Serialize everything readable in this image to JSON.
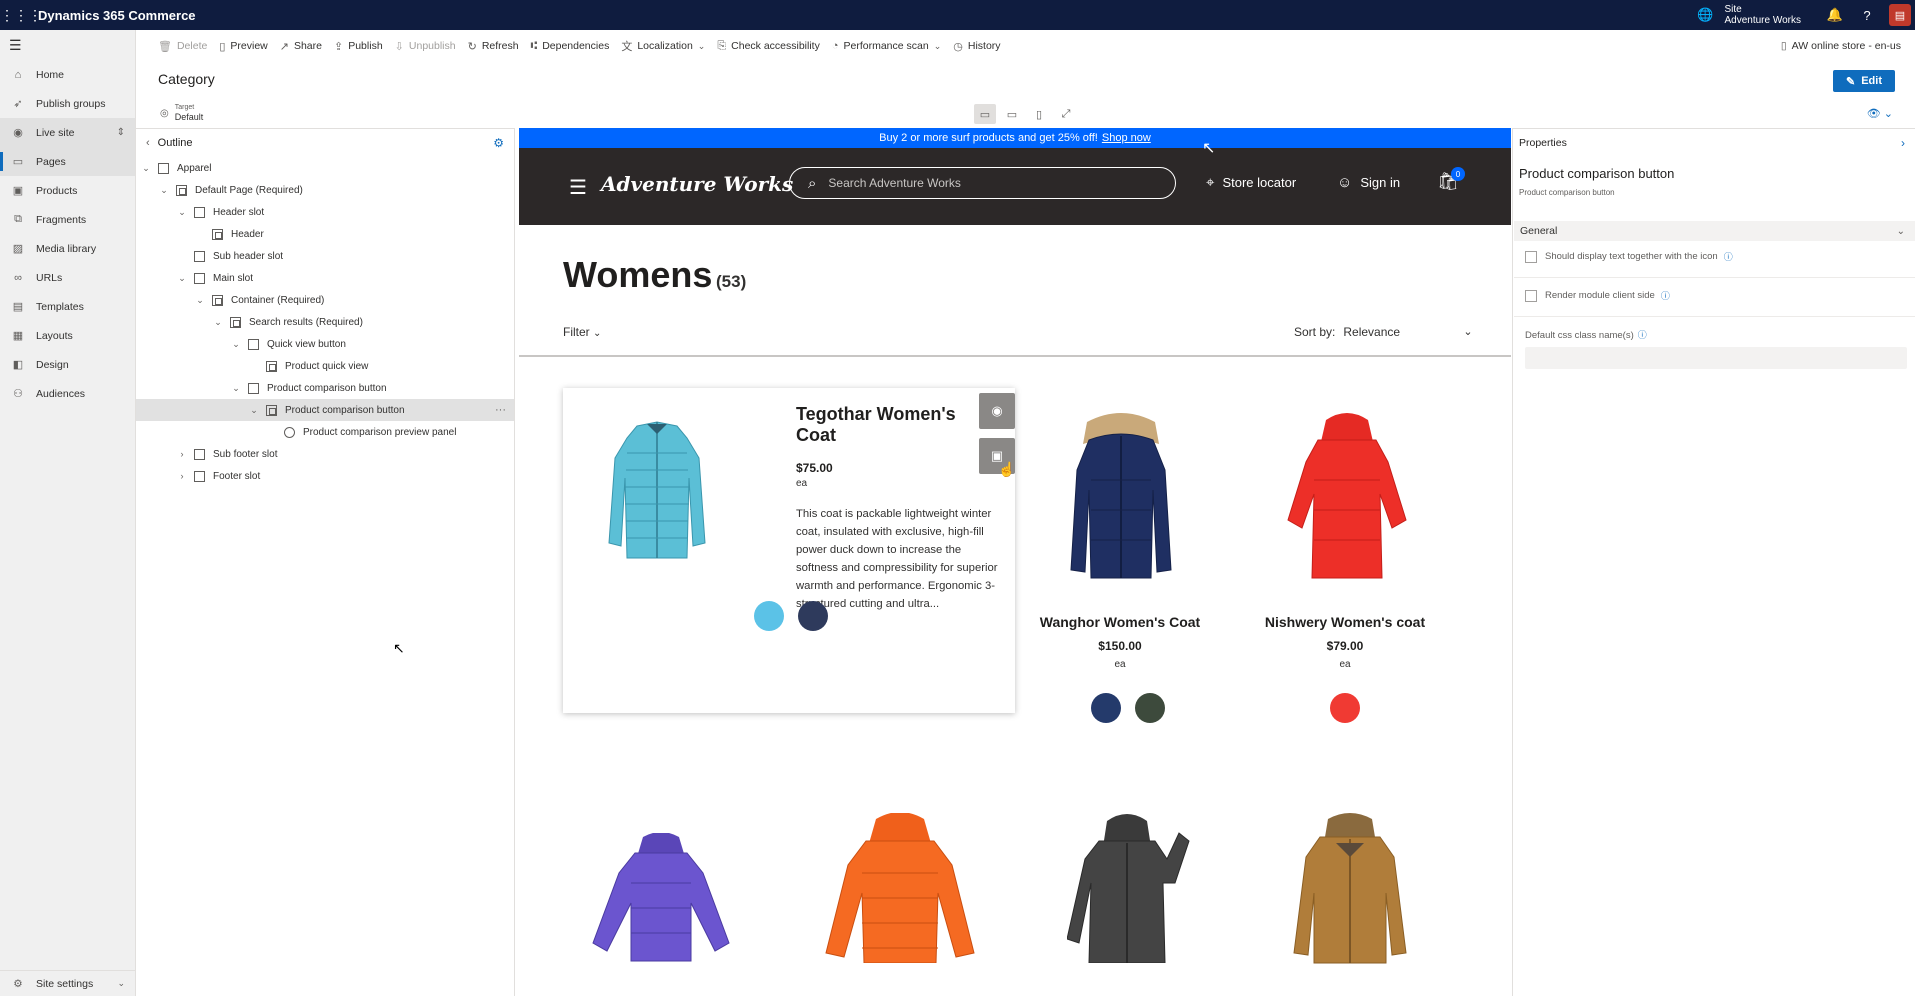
{
  "topbar": {
    "app_title": "Dynamics 365 Commerce",
    "site_label": "Site",
    "site_name": "Adventure Works",
    "waffle_icon": "waffle-icon",
    "avatar_color": "#c0392b"
  },
  "leftnav": {
    "items": [
      {
        "label": "Home",
        "icon": "home-icon"
      },
      {
        "label": "Publish groups",
        "icon": "rocket-icon"
      },
      {
        "label": "Live site",
        "icon": "broadcast-icon"
      },
      {
        "label": "Pages",
        "icon": "page-icon"
      },
      {
        "label": "Products",
        "icon": "box-icon"
      },
      {
        "label": "Fragments",
        "icon": "puzzle-icon"
      },
      {
        "label": "Media library",
        "icon": "image-icon"
      },
      {
        "label": "URLs",
        "icon": "link-icon"
      },
      {
        "label": "Templates",
        "icon": "template-icon"
      },
      {
        "label": "Layouts",
        "icon": "layout-icon"
      },
      {
        "label": "Design",
        "icon": "palette-icon"
      },
      {
        "label": "Audiences",
        "icon": "people-icon"
      }
    ],
    "site_settings": "Site settings"
  },
  "commands": {
    "delete": "Delete",
    "preview": "Preview",
    "share": "Share",
    "publish": "Publish",
    "unpublish": "Unpublish",
    "refresh": "Refresh",
    "dependencies": "Dependencies",
    "localization": "Localization",
    "check_accessibility": "Check accessibility",
    "performance_scan": "Performance scan",
    "history": "History",
    "store": "AW online store - en-us"
  },
  "page": {
    "title": "Category",
    "edit_label": "Edit",
    "target_label": "Target",
    "target_value": "Default"
  },
  "outline": {
    "title": "Outline",
    "rows": [
      {
        "label": "Apparel"
      },
      {
        "label": "Default Page (Required)"
      },
      {
        "label": "Header slot"
      },
      {
        "label": "Header"
      },
      {
        "label": "Sub header slot"
      },
      {
        "label": "Main slot"
      },
      {
        "label": "Container (Required)"
      },
      {
        "label": "Search results (Required)"
      },
      {
        "label": "Quick view button"
      },
      {
        "label": "Product quick view"
      },
      {
        "label": "Product comparison button"
      },
      {
        "label": "Product comparison button"
      },
      {
        "label": "Product comparison preview panel"
      },
      {
        "label": "Sub footer slot"
      },
      {
        "label": "Footer slot"
      }
    ]
  },
  "site": {
    "promo_text": "Buy 2 or more surf products and get 25% off!",
    "promo_link": "Shop now",
    "brand": "Adventure Works",
    "search_placeholder": "Search Adventure Works",
    "store_locator": "Store locator",
    "sign_in": "Sign in",
    "cart_count": "0",
    "accent": "#0066ff"
  },
  "plp": {
    "title": "Womens",
    "count": "(53)",
    "filter": "Filter",
    "sort_label": "Sort by:",
    "sort_value": "Relevance",
    "products": [
      {
        "name": "Tegothar Women's Coat",
        "price": "$75.00",
        "unit": "ea",
        "description": "This coat is packable lightweight winter coat, insulated with exclusive, high-fill power duck down to increase the softness and compressibility for superior warmth and performance. Ergonomic 3-structured cutting and ultra...",
        "swatches": [
          "#5bc2e7",
          "#2e3a5c"
        ]
      },
      {
        "name": "Wanghor Women's Coat",
        "price": "$150.00",
        "unit": "ea",
        "swatches": [
          "#243a6b",
          "#3d4a3c"
        ]
      },
      {
        "name": "Nishwery Women's coat",
        "price": "$79.00",
        "unit": "ea",
        "swatches": [
          "#f03a33"
        ]
      }
    ]
  },
  "properties": {
    "title": "Properties",
    "module_name": "Product comparison button",
    "module_sub": "Product comparison button",
    "group": "General",
    "display_text": "Should display text together with the icon",
    "render_client": "Render module client side",
    "css_class": "Default css class name(s)"
  }
}
